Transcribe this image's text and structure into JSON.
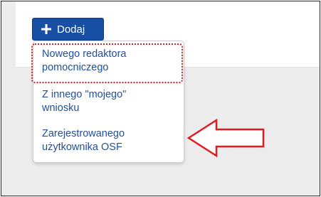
{
  "toolbar": {
    "add_label": "Dodaj",
    "add_icon": "plus-icon",
    "accent_color": "#164fa3"
  },
  "dropdown": {
    "items": [
      {
        "label_line1": "Nowego redaktora",
        "label_line2": "pomocniczego",
        "highlighted": true
      },
      {
        "label_line1": "Z innego \"mojego\"",
        "label_line2": "wniosku",
        "highlighted": false
      },
      {
        "label_line1": "Zarejestrowanego",
        "label_line2": "użytkownika OSF",
        "highlighted": false
      }
    ]
  },
  "annotations": {
    "highlight_color": "#d32027",
    "arrow_icon": "left-arrow-icon"
  }
}
